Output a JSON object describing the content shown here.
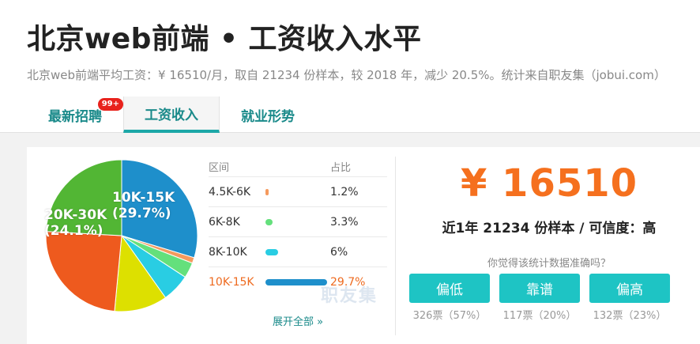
{
  "header": {
    "title": "北京web前端 • 工资收入水平",
    "summary": "北京web前端平均工资：¥ 16510/月，取自 21234 份样本，较 2018 年，减少 20.5%。统计来自职友集（jobui.com）"
  },
  "tabs": [
    {
      "label": "最新招聘",
      "badge": "99+"
    },
    {
      "label": "工资收入",
      "active": true
    },
    {
      "label": "就业形势"
    }
  ],
  "chart_data": {
    "type": "pie",
    "slices": [
      {
        "label": "10K-15K",
        "pct": 29.7,
        "color": "#1e8fcb"
      },
      {
        "label": "4.5K-6K",
        "pct": 1.2,
        "color": "#f59a5e"
      },
      {
        "label": "6K-8K",
        "pct": 3.3,
        "color": "#64e07c"
      },
      {
        "label": "8K-10K",
        "pct": 6.0,
        "color": "#29cde3"
      },
      {
        "label": "",
        "pct": 11.3,
        "color": "#dde000"
      },
      {
        "label": "",
        "pct": 24.4,
        "color": "#ee5a1e"
      },
      {
        "label": "20K-30K",
        "pct": 24.1,
        "color": "#52b634"
      }
    ],
    "labels": {
      "a_range": "10K-15K",
      "a_pct": "(29.7%)",
      "b_range": "20K-30K",
      "b_pct": "(24.1%)"
    }
  },
  "table": {
    "col_range": "区间",
    "col_pct": "占比",
    "rows": [
      {
        "range": "4.5K-6K",
        "pct": "1.2%",
        "color": "#f59a5e"
      },
      {
        "range": "6K-8K",
        "pct": "3.3%",
        "color": "#64e07c"
      },
      {
        "range": "8K-10K",
        "pct": "6%",
        "color": "#29cde3"
      },
      {
        "range": "10K-15K",
        "pct": "29.7%",
        "color": "#1e8fcb"
      }
    ],
    "expand": "展开全部 »"
  },
  "watermark": "职友集",
  "stats": {
    "salary": "¥ 16510",
    "sample": "近1年 21234 份样本 / 可信度：高",
    "question": "你觉得该统计数据准确吗？"
  },
  "votes": [
    {
      "label": "偏低",
      "count": "326票（57%）"
    },
    {
      "label": "靠谱",
      "count": "117票（20%）"
    },
    {
      "label": "偏高",
      "count": "132票（23%）"
    }
  ]
}
